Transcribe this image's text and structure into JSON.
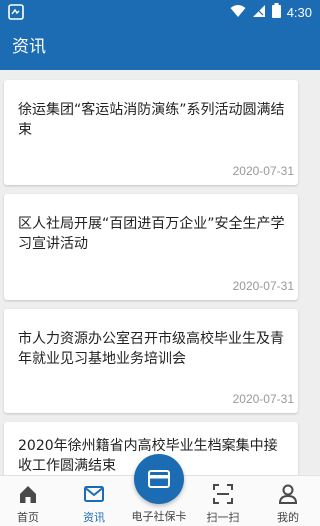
{
  "status_bar": {
    "time": "4:30",
    "icons": [
      "app-notification-icon",
      "wifi-icon",
      "signal-icon",
      "battery-icon"
    ]
  },
  "app_bar": {
    "title": "资讯"
  },
  "news": [
    {
      "title": "徐运集团“客运站消防演练”系列活动圆满结束",
      "date": "2020-07-31"
    },
    {
      "title": "区人社局开展“百团进百万企业”安全生产学习宣讲活动",
      "date": "2020-07-31"
    },
    {
      "title": "市人力资源办公室召开市级高校毕业生及青年就业见习基地业务培训会",
      "date": "2020-07-31"
    },
    {
      "title": "2020年徐州籍省内高校毕业生档案集中接收工作圆满结束",
      "date": ""
    }
  ],
  "bottom_nav": {
    "home": "首页",
    "news": "资讯",
    "card": "电子社保卡",
    "scan": "扫一扫",
    "mine": "我的",
    "active": "news"
  },
  "colors": {
    "primary": "#1c6cb4",
    "background": "#eeeeee"
  }
}
